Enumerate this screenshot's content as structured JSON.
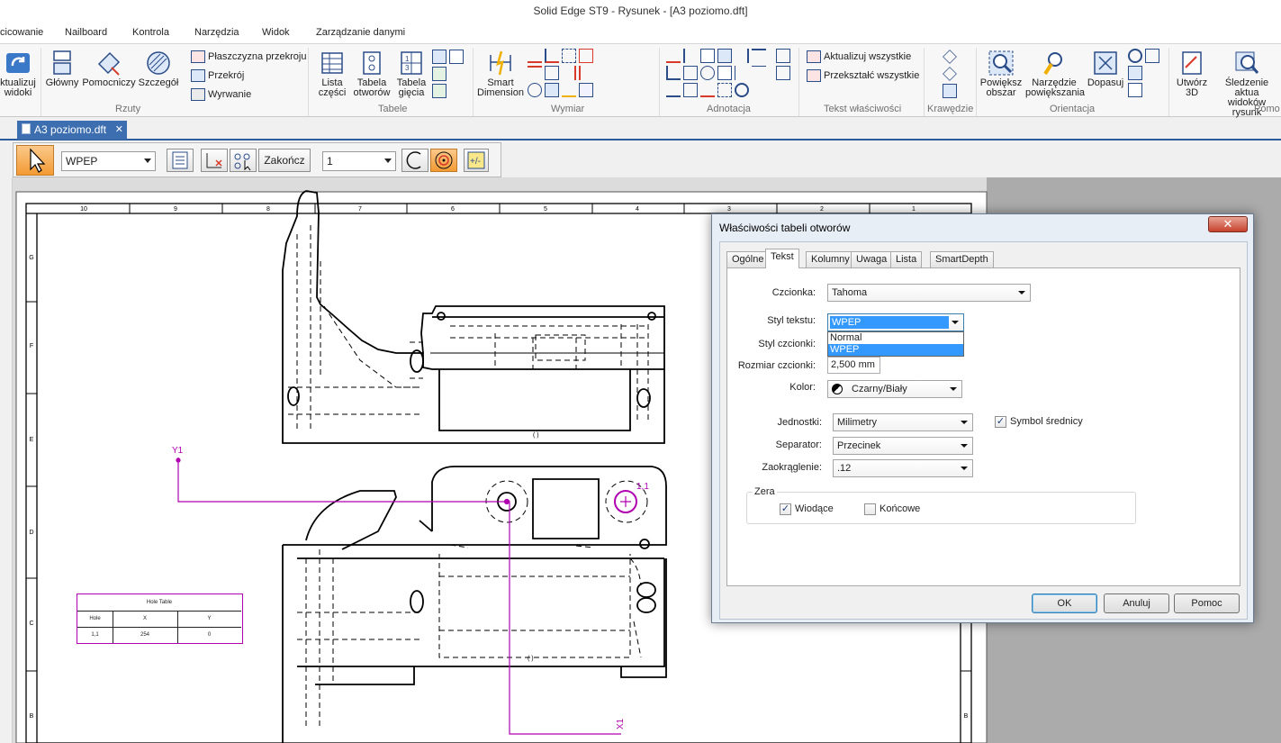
{
  "window": {
    "title": "Solid Edge ST9 - Rysunek - [A3 poziomo.dft]"
  },
  "ribbon_tabs": [
    "cicowanie",
    "Nailboard",
    "Kontrola",
    "Narzędzia",
    "Widok",
    "Zarządzanie danymi"
  ],
  "ribbon": {
    "update_views": {
      "line1": "ktualizuj",
      "line2": "widoki"
    },
    "rzuty": {
      "label": "Rzuty",
      "glowny": "Główny",
      "pomocniczy": "Pomocniczy",
      "szczegol": "Szczegół",
      "plaszczyzna": "Płaszczyzna przekroju",
      "przekroj": "Przekrój",
      "wyrwanie": "Wyrwanie"
    },
    "tabele": {
      "label": "Tabele",
      "lista": {
        "line1": "Lista",
        "line2": "części"
      },
      "tabela_otworow": {
        "line1": "Tabela",
        "line2": "otworów"
      },
      "tabela_giecia": {
        "line1": "Tabela",
        "line2": "gięcia"
      }
    },
    "wymiar": {
      "label": "Wymiar",
      "smart": {
        "line1": "Smart",
        "line2": "Dimension"
      }
    },
    "adnotacja": {
      "label": "Adnotacja"
    },
    "tekst_wlasciwosci": {
      "label": "Tekst właściwości",
      "aktualizuj": "Aktualizuj wszystkie",
      "przeksztalc": "Przekształć wszystkie"
    },
    "krawedzie": {
      "label": "Krawędzie"
    },
    "orientacja": {
      "label": "Orientacja",
      "powieksz": {
        "line1": "Powiększ",
        "line2": "obszar"
      },
      "narzedzie": {
        "line1": "Narzędzie",
        "line2": "powiększania"
      },
      "dopasuj": "Dopasuj"
    },
    "pomoc": {
      "label": "Pomo",
      "utworz": {
        "line1": "Utwórz",
        "line2": "3D"
      },
      "sledzenie": {
        "line1": "Śledzenie aktua",
        "line2": "widoków rysunk"
      }
    }
  },
  "document_tab": {
    "label": "A3 poziomo.dft",
    "close": "✕"
  },
  "command_bar": {
    "style_combo": "WPEP",
    "finish_button": "Zakończ",
    "number_combo": "1"
  },
  "sheet": {
    "column_labels": [
      "10",
      "9",
      "8",
      "7",
      "6",
      "5",
      "4",
      "3",
      "2",
      "1"
    ],
    "row_labels": [
      "G",
      "F",
      "E",
      "D",
      "C",
      "B"
    ],
    "row_label_right": "B",
    "axis_y": "Y1",
    "axis_x": "X1",
    "hole_label": "1,1",
    "hole_table": {
      "title": "Hole Table",
      "headers": [
        "Hole",
        "X",
        "Y"
      ],
      "rows": [
        [
          "1,1",
          "254",
          "0"
        ]
      ]
    }
  },
  "dialog": {
    "title": "Właściwości tabeli otworów",
    "close": "✕",
    "tabs": [
      "Ogólne",
      "Tekst",
      "Kolumny",
      "Uwaga",
      "Lista",
      "SmartDepth"
    ],
    "active_tab": "Tekst",
    "fields": {
      "czcionka": {
        "label": "Czcionka:",
        "value": "Tahoma"
      },
      "styl_tekstu": {
        "label": "Styl tekstu:",
        "value": "WPEP",
        "options": [
          "Normal",
          "WPEP"
        ]
      },
      "styl_czcionki": {
        "label": "Styl czcionki:"
      },
      "rozmiar": {
        "label": "Rozmiar czcionki:",
        "value": "2,500 mm"
      },
      "kolor": {
        "label": "Kolor:",
        "value": "Czarny/Biały"
      },
      "jednostki": {
        "label": "Jednostki:",
        "value": "Milimetry"
      },
      "symbol": {
        "label": "Symbol średnicy",
        "checked": true
      },
      "separator": {
        "label": "Separator:",
        "value": "Przecinek"
      },
      "zaokraglenie": {
        "label": "Zaokrąglenie:",
        "value": ".12"
      }
    },
    "zera": {
      "legend": "Zera",
      "wiodace": "Wiodące",
      "wiodace_checked": true,
      "koncowe": "Końcowe",
      "koncowe_checked": false
    },
    "buttons": {
      "ok": "OK",
      "cancel": "Anuluj",
      "help": "Pomoc"
    }
  },
  "colors": {
    "accent": "#3c6eb0",
    "magenta": "#b000b0",
    "selection": "#3399ff",
    "command_active": "#f5a238"
  }
}
